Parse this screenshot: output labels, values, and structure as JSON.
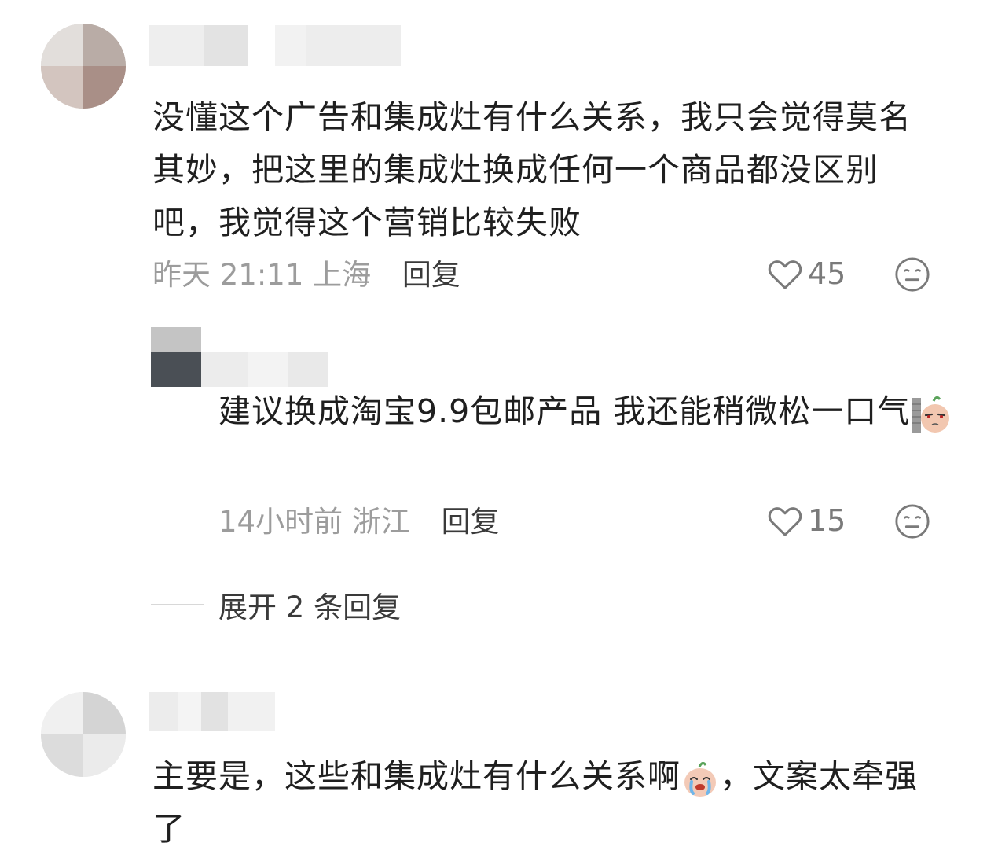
{
  "comments": [
    {
      "text": "没懂这个广告和集成灶有什么关系，我只会觉得莫名其妙，把这里的集成灶换成任何一个商品都没区别吧，我觉得这个营销比较失败",
      "time": "昨天 21:11",
      "location": "上海",
      "reply_label": "回复",
      "likes": "45"
    },
    {
      "text_before": "建议换成淘宝9.9包邮产品 我还能稍微松一口气",
      "time": "14小时前",
      "location": "浙江",
      "reply_label": "回复",
      "likes": "15"
    },
    {
      "text_before": "主要是，这些和集成灶有什么关系啊",
      "text_after": "，文案太牵强了"
    }
  ],
  "expand_replies": "展开 2 条回复",
  "icons": {
    "like": "heart-outline-icon",
    "dislike": "meh-face-icon",
    "sticker_peek": "peeking-sticker-icon",
    "sticker_cry": "crying-sticker-icon"
  },
  "colors": {
    "text": "#1f1f1f",
    "meta": "#9c9c9c",
    "reply": "#3a3a3a",
    "icon": "#7a7a7a"
  }
}
